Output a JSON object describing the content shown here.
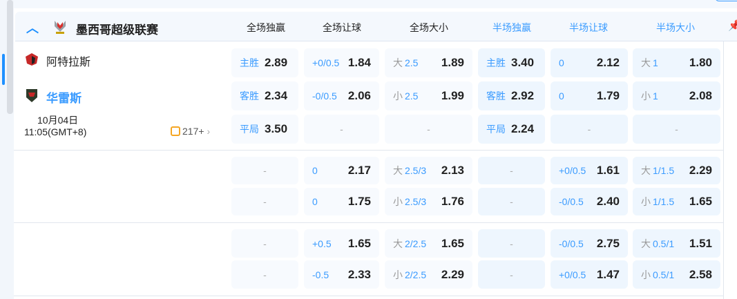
{
  "league": {
    "name": "墨西哥超级联赛",
    "collapse_icon": "chevron-up-icon"
  },
  "columns": [
    {
      "label": "全场独赢",
      "color": "#222222"
    },
    {
      "label": "全场让球",
      "color": "#222222"
    },
    {
      "label": "全场大小",
      "color": "#222222"
    },
    {
      "label": "半场独赢",
      "color": "#3a9bff"
    },
    {
      "label": "半场让球",
      "color": "#3a9bff"
    },
    {
      "label": "半场大小",
      "color": "#3a9bff"
    }
  ],
  "match": {
    "home": "阿特拉斯",
    "away": "华雷斯",
    "date": "10月04日",
    "time": "11:05(GMT+8)",
    "more_count": "217+",
    "more_chevron": "›"
  },
  "empty": "-",
  "blocks": [
    {
      "rows": [
        [
          {
            "line": "主胜",
            "odds": "2.89",
            "lab": true
          },
          {
            "line": "+0/0.5",
            "odds": "1.84"
          },
          {
            "pre": "大",
            "line": "2.5",
            "odds": "1.89"
          },
          {
            "line": "主胜",
            "odds": "3.40",
            "lab": true
          },
          {
            "line": "0",
            "odds": "2.12"
          },
          {
            "pre": "大",
            "line": "1",
            "odds": "1.80"
          }
        ],
        [
          {
            "line": "客胜",
            "odds": "2.34",
            "lab": true
          },
          {
            "line": "-0/0.5",
            "odds": "2.06"
          },
          {
            "pre": "小",
            "line": "2.5",
            "odds": "1.99"
          },
          {
            "line": "客胜",
            "odds": "2.92",
            "lab": true
          },
          {
            "line": "0",
            "odds": "1.79"
          },
          {
            "pre": "小",
            "line": "1",
            "odds": "2.08"
          }
        ],
        [
          {
            "line": "平局",
            "odds": "3.50",
            "lab": true
          },
          null,
          null,
          {
            "line": "平局",
            "odds": "2.24",
            "lab": true
          },
          null,
          null
        ]
      ]
    },
    {
      "rows": [
        [
          null,
          {
            "line": "0",
            "odds": "2.17"
          },
          {
            "pre": "大",
            "line": "2.5/3",
            "odds": "2.13"
          },
          null,
          {
            "line": "+0/0.5",
            "odds": "1.61"
          },
          {
            "pre": "大",
            "line": "1/1.5",
            "odds": "2.29"
          }
        ],
        [
          null,
          {
            "line": "0",
            "odds": "1.75"
          },
          {
            "pre": "小",
            "line": "2.5/3",
            "odds": "1.76"
          },
          null,
          {
            "line": "-0/0.5",
            "odds": "2.40"
          },
          {
            "pre": "小",
            "line": "1/1.5",
            "odds": "1.65"
          }
        ]
      ]
    },
    {
      "rows": [
        [
          null,
          {
            "line": "+0.5",
            "odds": "1.65"
          },
          {
            "pre": "大",
            "line": "2/2.5",
            "odds": "1.65"
          },
          null,
          {
            "line": "-0/0.5",
            "odds": "2.75"
          },
          {
            "pre": "大",
            "line": "0.5/1",
            "odds": "1.51"
          }
        ],
        [
          null,
          {
            "line": "-0.5",
            "odds": "2.33"
          },
          {
            "pre": "小",
            "line": "2/2.5",
            "odds": "2.29"
          },
          null,
          {
            "line": "+0/0.5",
            "odds": "1.47"
          },
          {
            "pre": "小",
            "line": "0.5/1",
            "odds": "2.58"
          }
        ]
      ]
    }
  ]
}
